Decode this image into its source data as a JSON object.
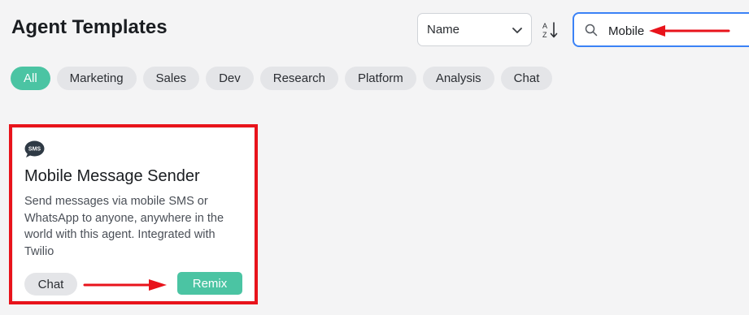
{
  "header": {
    "title": "Agent Templates"
  },
  "sort": {
    "selected": "Name",
    "direction_icon": "sort-az-down-icon"
  },
  "search": {
    "value": "Mobile",
    "icon": "search-icon"
  },
  "filters": {
    "chips": [
      {
        "label": "All",
        "active": true
      },
      {
        "label": "Marketing",
        "active": false
      },
      {
        "label": "Sales",
        "active": false
      },
      {
        "label": "Dev",
        "active": false
      },
      {
        "label": "Research",
        "active": false
      },
      {
        "label": "Platform",
        "active": false
      },
      {
        "label": "Analysis",
        "active": false
      },
      {
        "label": "Chat",
        "active": false
      }
    ]
  },
  "cards": [
    {
      "icon": "sms-icon",
      "icon_text": "SMS",
      "title": "Mobile Message Sender",
      "description": "Send messages via mobile SMS or WhatsApp to anyone, anywhere in the world with this agent. Integrated with Twilio",
      "chat_label": "Chat",
      "remix_label": "Remix"
    }
  ],
  "annotations": {
    "color": "#e8131b"
  },
  "colors": {
    "accent": "#4bc4a3",
    "search_border": "#3b82f6",
    "background": "#f4f4f5"
  }
}
